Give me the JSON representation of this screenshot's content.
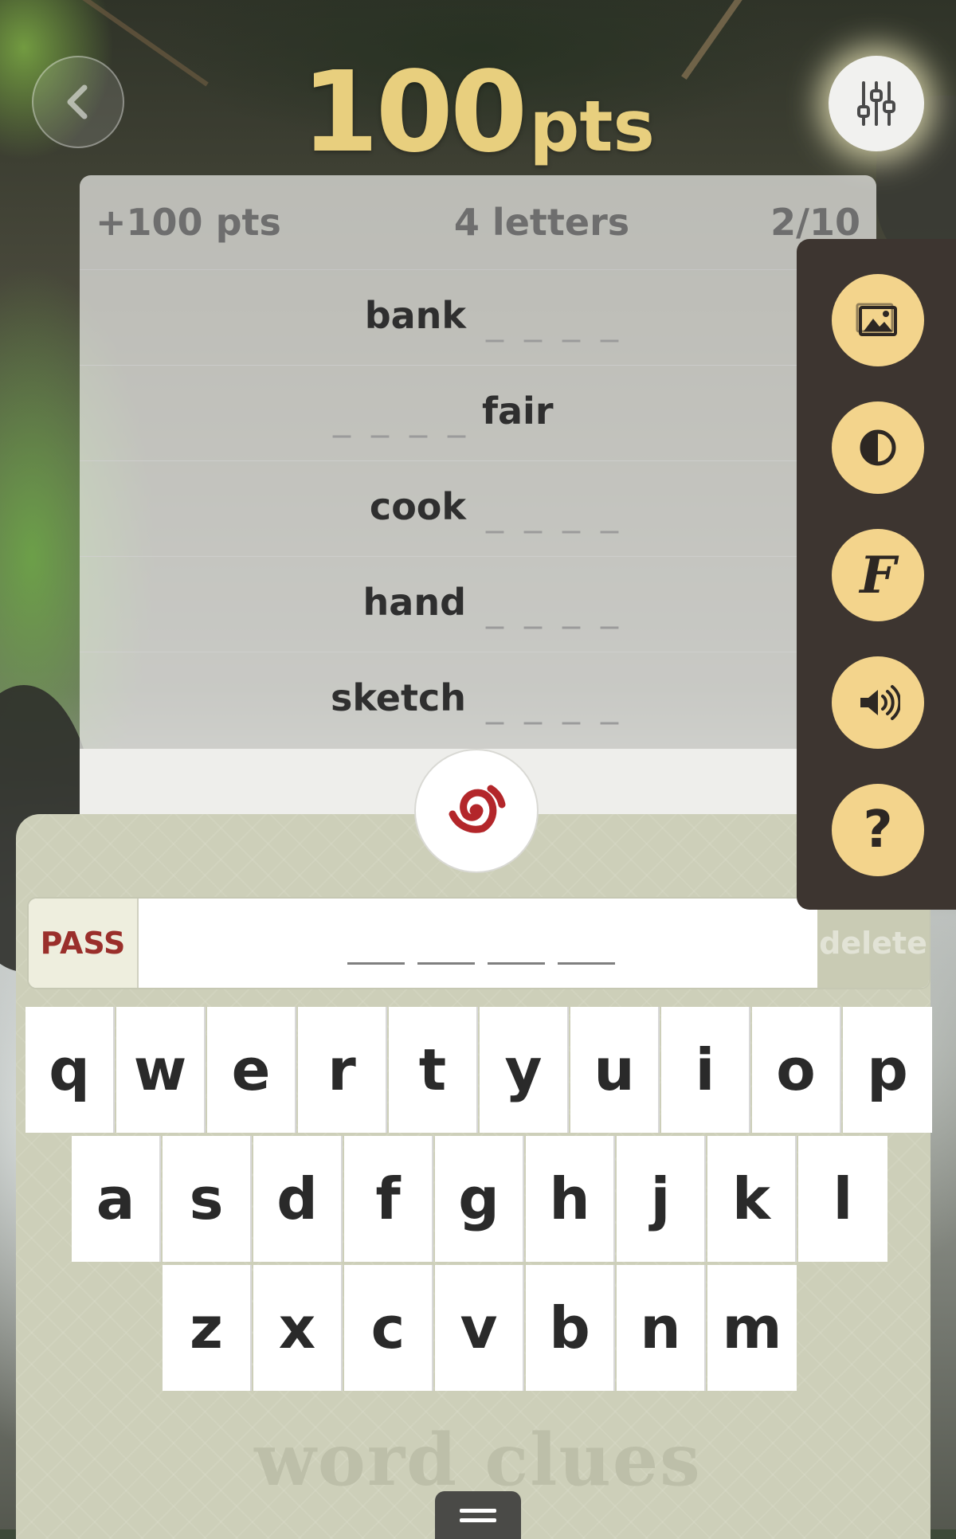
{
  "header": {
    "score_value": "100",
    "score_unit": "pts",
    "back_icon": "chevron-left-icon",
    "settings_icon": "sliders-icon"
  },
  "panel": {
    "points_label": "+100 pts",
    "letters_label": "4 letters",
    "progress_label": "2/10",
    "clues": [
      {
        "word": "bank",
        "blanks": "_ _ _ _",
        "side": "right"
      },
      {
        "word": "fair",
        "blanks": "_ _ _ _",
        "side": "left"
      },
      {
        "word": "cook",
        "blanks": "_ _ _ _",
        "side": "right"
      },
      {
        "word": "hand",
        "blanks": "_ _ _ _",
        "side": "right"
      },
      {
        "word": "sketch",
        "blanks": "_ _ _ _",
        "side": "right"
      }
    ]
  },
  "side_menu": {
    "items": [
      {
        "icon": "image-icon"
      },
      {
        "icon": "contrast-icon"
      },
      {
        "icon": "font-icon",
        "glyph": "F"
      },
      {
        "icon": "speaker-icon"
      },
      {
        "icon": "help-icon",
        "glyph": "?"
      }
    ]
  },
  "answer": {
    "pass_label": "PASS",
    "delete_label": "delete",
    "slots": 4
  },
  "keyboard": {
    "rows": [
      [
        "q",
        "w",
        "e",
        "r",
        "t",
        "y",
        "u",
        "i",
        "o",
        "p"
      ],
      [
        "a",
        "s",
        "d",
        "f",
        "g",
        "h",
        "j",
        "k",
        "l"
      ],
      [
        "z",
        "x",
        "c",
        "v",
        "b",
        "n",
        "m"
      ]
    ]
  },
  "branding": {
    "logo_icon": "spiral-logo-icon",
    "wordmark": "word clues",
    "handle_icon": "menu-handle-icon"
  },
  "colors": {
    "score": "#e8cf7e",
    "side_menu_bg": "#3d3530",
    "side_button": "#f3d48c",
    "pass_text": "#9a2f2b",
    "keyboard_bg": "#cdcfb9"
  }
}
